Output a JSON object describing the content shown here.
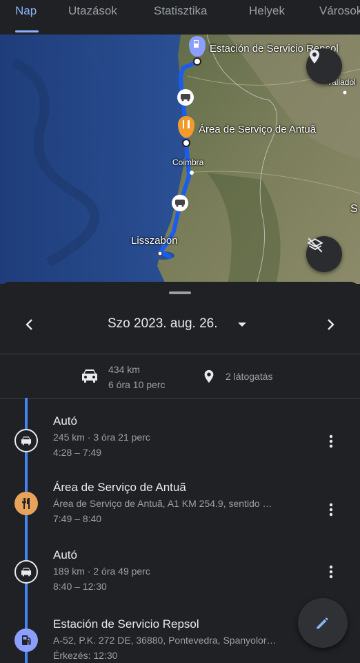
{
  "tabs": [
    {
      "label": "Nap",
      "active": true
    },
    {
      "label": "Utazások"
    },
    {
      "label": "Statisztika"
    },
    {
      "label": "Helyek"
    },
    {
      "label": "Városok"
    }
  ],
  "map": {
    "labels": {
      "repsol": "Estación de Servicio Repsol",
      "antua": "Área de Serviço de Antuã",
      "coimbra": "Coimbra",
      "lisbon": "Lisszabon",
      "valladolid": "Valladol",
      "edge": "S"
    }
  },
  "date": {
    "label": "Szo 2023. aug. 26."
  },
  "summary": {
    "distance": "434 km",
    "duration": "6 óra 10 perc",
    "visits": "2 látogatás"
  },
  "timeline": [
    {
      "type": "car",
      "title": "Autó",
      "line1": "245 km · 3 óra 21 perc",
      "line2": "4:28 – 7:49"
    },
    {
      "type": "food",
      "title": "Área de Serviço de Antuã",
      "line1": "Área de Serviço de Antuã, A1 KM 254.9, sentido …",
      "line2": "7:49 – 8:40"
    },
    {
      "type": "car",
      "title": "Autó",
      "line1": "189 km · 2 óra 49 perc",
      "line2": "8:40 – 12:30"
    },
    {
      "type": "fuel",
      "title": "Estación de Servicio Repsol",
      "line1": "A-52, P.K. 272 DE, 36880, Pontevedra, Spanyolor…",
      "line2": "Érkezés: 12:30"
    }
  ],
  "colors": {
    "accent": "#8ab4f8",
    "route": "#1a5cf0",
    "timeline": "#4285f4",
    "food": "#e8a35a",
    "fuel": "#8c9eff"
  }
}
